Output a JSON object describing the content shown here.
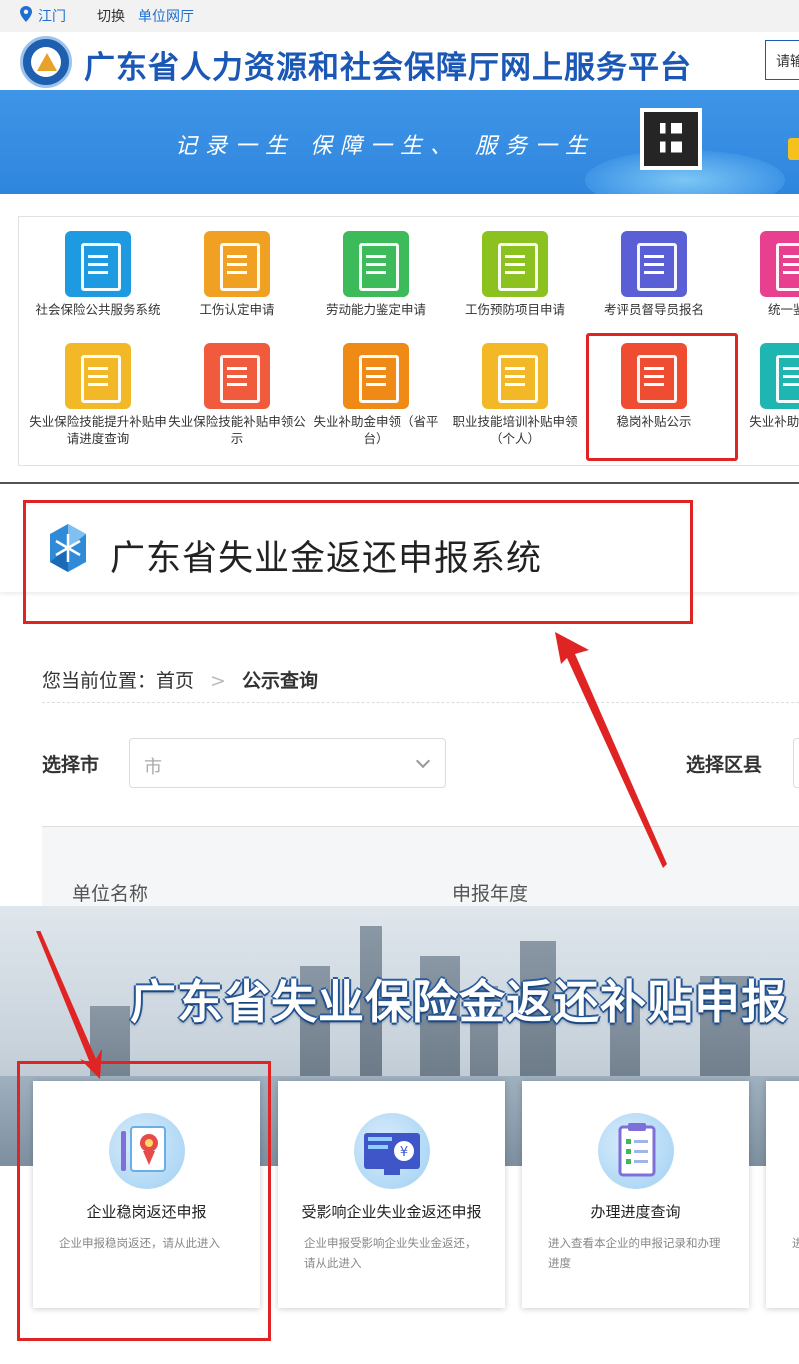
{
  "portal": {
    "city": "江门",
    "switch_label": "切换",
    "hall_link": "单位网厅",
    "site_title": "广东省人力资源和社会保障厅网上服务平台",
    "search_text": "请输",
    "slogan": "记录一生  保障一生、  服务一生",
    "services_row1": [
      {
        "label": "社会保险公共服务系统",
        "color": "#1e9be0",
        "icon": "user-search-icon"
      },
      {
        "label": "工伤认定申请",
        "color": "#f0a022",
        "icon": "document-icon"
      },
      {
        "label": "劳动能力鉴定申请",
        "color": "#3dba5a",
        "icon": "users-icon"
      },
      {
        "label": "工伤预防项目申请",
        "color": "#8cc21f",
        "icon": "form-icon"
      },
      {
        "label": "考评员督导员报名",
        "color": "#5b5fd6",
        "icon": "badge-icon"
      },
      {
        "label": "统一鉴定",
        "color": "#e8408e",
        "icon": "monitor-icon"
      }
    ],
    "services_row2": [
      {
        "label": "失业保险技能提升补贴申请进度查询",
        "color": "#f3b827",
        "icon": "pill-box-icon"
      },
      {
        "label": "失业保险技能补贴申领公示",
        "color": "#ef5b3c",
        "icon": "id-card-icon"
      },
      {
        "label": "失业补助金申领（省平台）",
        "color": "#f08a16",
        "icon": "yen-document-icon"
      },
      {
        "label": "职业技能培训补贴申领（个人）",
        "color": "#f3b827",
        "icon": "pill-box-icon"
      },
      {
        "label": "稳岗补贴公示",
        "color": "#ef4d32",
        "icon": "copy-icon"
      },
      {
        "label": "失业补助金平台",
        "color": "#1fb5b0",
        "icon": "tablet-icon"
      }
    ]
  },
  "system": {
    "title": "广东省失业金返还申报系统",
    "breadcrumb_prefix": "您当前位置：",
    "breadcrumb_home": "首页",
    "breadcrumb_sep": ">",
    "breadcrumb_current": "公示查询",
    "city_label": "选择市",
    "city_placeholder": "市",
    "district_label": "选择区县",
    "columns": [
      "单位名称",
      "申报年度"
    ]
  },
  "subsidy": {
    "hero_title": "广东省失业保险金返还补贴申报",
    "cards": [
      {
        "title": "企业稳岗返还申报",
        "desc": "企业申报稳岗返还，请从此进入",
        "icon": "certificate-icon"
      },
      {
        "title": "受影响企业失业金返还申报",
        "desc": "企业申报受影响企业失业金返还，请从此进入",
        "icon": "yen-screen-icon"
      },
      {
        "title": "办理进度查询",
        "desc": "进入查看本企业的申报记录和办理进度",
        "icon": "checklist-icon"
      },
      {
        "title": "",
        "desc": "进",
        "icon": "card-icon"
      }
    ]
  },
  "colors": {
    "brand_blue": "#1b57b5",
    "highlight_red": "#e02424"
  }
}
